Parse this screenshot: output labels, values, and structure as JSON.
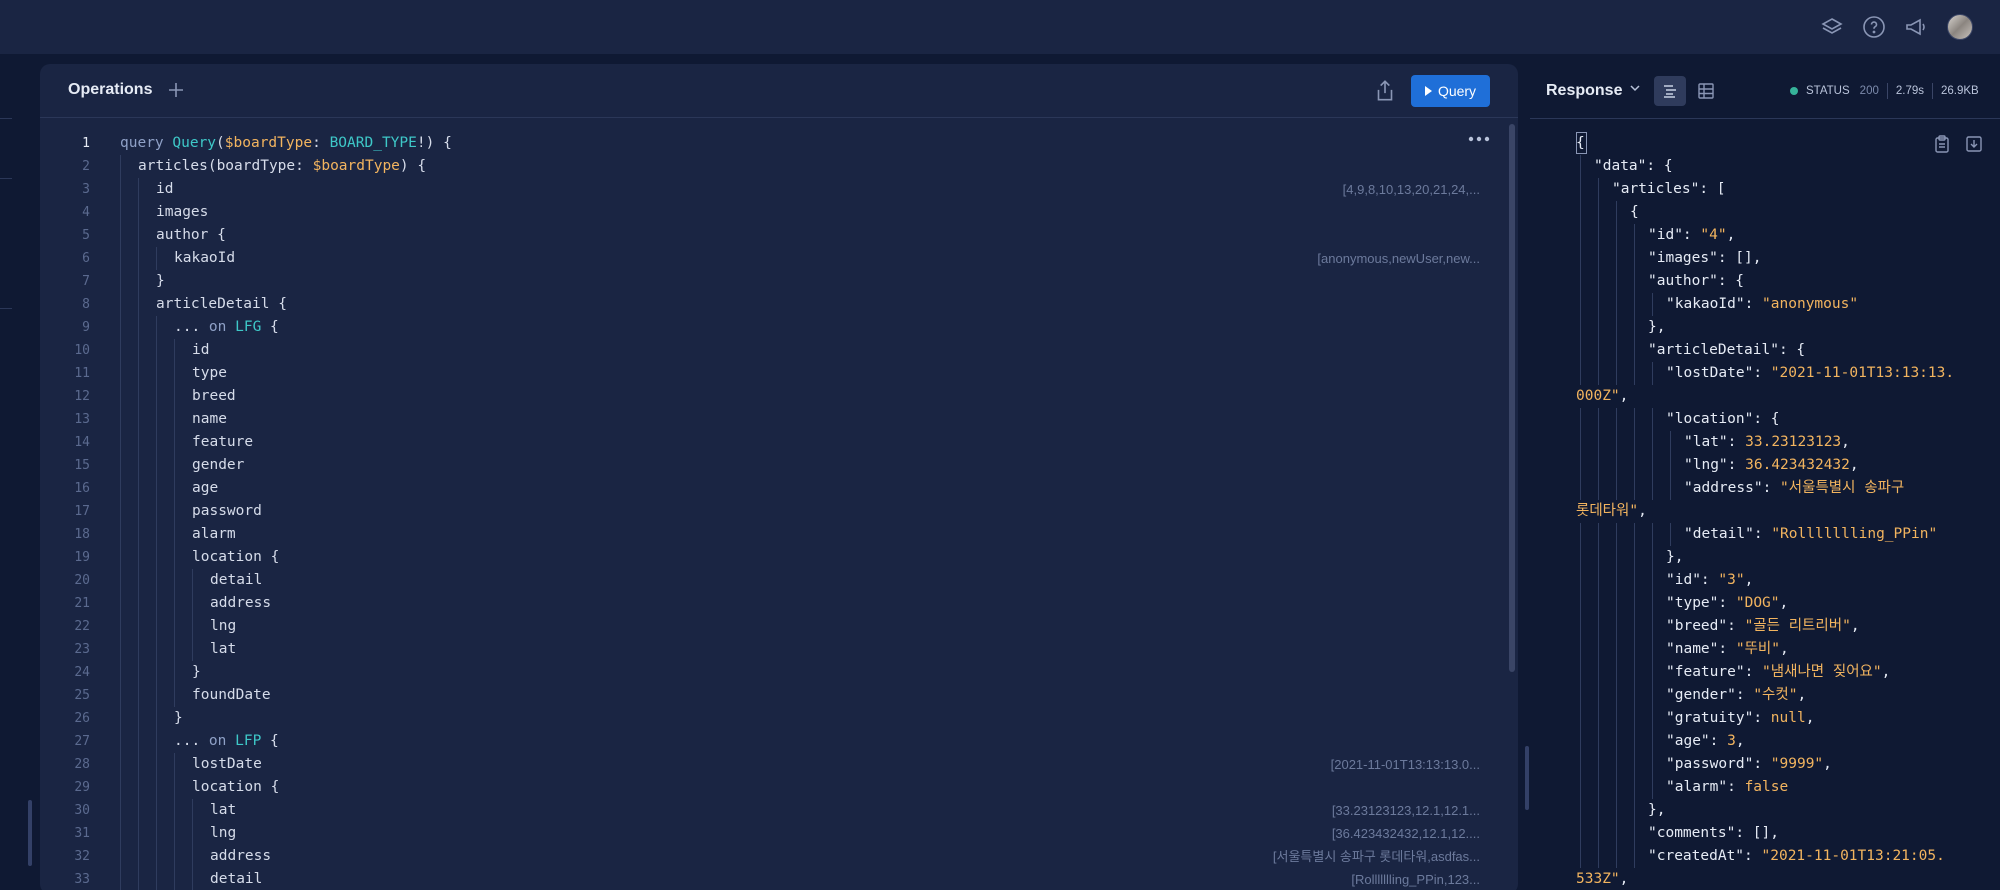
{
  "topbar": {
    "icons": [
      "layers-icon",
      "help-icon",
      "megaphone-icon"
    ],
    "avatar": "user-avatar"
  },
  "operations": {
    "title": "Operations",
    "add_icon": "plus-icon",
    "share_icon": "share-icon",
    "query_button": "Query",
    "menu_icon": "more-horizontal-icon",
    "lines": [
      {
        "n": "1",
        "indent": 0,
        "parts": [
          [
            "kw",
            "query "
          ],
          [
            "ty",
            "Query"
          ],
          [
            "p",
            "("
          ],
          [
            "var",
            "$boardType"
          ],
          [
            "p",
            ": "
          ],
          [
            "ty",
            "BOARD_TYPE"
          ],
          [
            "p",
            "!) {"
          ]
        ],
        "hint": ""
      },
      {
        "n": "2",
        "indent": 1,
        "parts": [
          [
            "p",
            "articles(boardType: "
          ],
          [
            "var",
            "$boardType"
          ],
          [
            "p",
            ") {"
          ]
        ],
        "hint": ""
      },
      {
        "n": "3",
        "indent": 2,
        "parts": [
          [
            "p",
            "id"
          ]
        ],
        "hint": "[4,9,8,10,13,20,21,24,..."
      },
      {
        "n": "4",
        "indent": 2,
        "parts": [
          [
            "p",
            "images"
          ]
        ],
        "hint": ""
      },
      {
        "n": "5",
        "indent": 2,
        "parts": [
          [
            "p",
            "author {"
          ]
        ],
        "hint": ""
      },
      {
        "n": "6",
        "indent": 3,
        "parts": [
          [
            "p",
            "kakaoId"
          ]
        ],
        "hint": "[anonymous,newUser,new..."
      },
      {
        "n": "7",
        "indent": 2,
        "parts": [
          [
            "p",
            "}"
          ]
        ],
        "hint": ""
      },
      {
        "n": "8",
        "indent": 2,
        "parts": [
          [
            "p",
            "articleDetail {"
          ]
        ],
        "hint": ""
      },
      {
        "n": "9",
        "indent": 3,
        "parts": [
          [
            "p",
            "... "
          ],
          [
            "kw",
            "on "
          ],
          [
            "ty",
            "LFG"
          ],
          [
            "p",
            " {"
          ]
        ],
        "hint": ""
      },
      {
        "n": "10",
        "indent": 4,
        "parts": [
          [
            "p",
            "id"
          ]
        ],
        "hint": ""
      },
      {
        "n": "11",
        "indent": 4,
        "parts": [
          [
            "p",
            "type"
          ]
        ],
        "hint": ""
      },
      {
        "n": "12",
        "indent": 4,
        "parts": [
          [
            "p",
            "breed"
          ]
        ],
        "hint": ""
      },
      {
        "n": "13",
        "indent": 4,
        "parts": [
          [
            "p",
            "name"
          ]
        ],
        "hint": ""
      },
      {
        "n": "14",
        "indent": 4,
        "parts": [
          [
            "p",
            "feature"
          ]
        ],
        "hint": ""
      },
      {
        "n": "15",
        "indent": 4,
        "parts": [
          [
            "p",
            "gender"
          ]
        ],
        "hint": ""
      },
      {
        "n": "16",
        "indent": 4,
        "parts": [
          [
            "p",
            "age"
          ]
        ],
        "hint": ""
      },
      {
        "n": "17",
        "indent": 4,
        "parts": [
          [
            "p",
            "password"
          ]
        ],
        "hint": ""
      },
      {
        "n": "18",
        "indent": 4,
        "parts": [
          [
            "p",
            "alarm"
          ]
        ],
        "hint": ""
      },
      {
        "n": "19",
        "indent": 4,
        "parts": [
          [
            "p",
            "location {"
          ]
        ],
        "hint": ""
      },
      {
        "n": "20",
        "indent": 5,
        "parts": [
          [
            "p",
            "detail"
          ]
        ],
        "hint": ""
      },
      {
        "n": "21",
        "indent": 5,
        "parts": [
          [
            "p",
            "address"
          ]
        ],
        "hint": ""
      },
      {
        "n": "22",
        "indent": 5,
        "parts": [
          [
            "p",
            "lng"
          ]
        ],
        "hint": ""
      },
      {
        "n": "23",
        "indent": 5,
        "parts": [
          [
            "p",
            "lat"
          ]
        ],
        "hint": ""
      },
      {
        "n": "24",
        "indent": 4,
        "parts": [
          [
            "p",
            "}"
          ]
        ],
        "hint": ""
      },
      {
        "n": "25",
        "indent": 4,
        "parts": [
          [
            "p",
            "foundDate"
          ]
        ],
        "hint": ""
      },
      {
        "n": "26",
        "indent": 3,
        "parts": [
          [
            "p",
            "}"
          ]
        ],
        "hint": ""
      },
      {
        "n": "27",
        "indent": 3,
        "parts": [
          [
            "p",
            "... "
          ],
          [
            "kw",
            "on "
          ],
          [
            "ty",
            "LFP"
          ],
          [
            "p",
            " {"
          ]
        ],
        "hint": ""
      },
      {
        "n": "28",
        "indent": 4,
        "parts": [
          [
            "p",
            "lostDate"
          ]
        ],
        "hint": "[2021-11-01T13:13:13.0..."
      },
      {
        "n": "29",
        "indent": 4,
        "parts": [
          [
            "p",
            "location {"
          ]
        ],
        "hint": ""
      },
      {
        "n": "30",
        "indent": 5,
        "parts": [
          [
            "p",
            "lat"
          ]
        ],
        "hint": "[33.23123123,12.1,12.1..."
      },
      {
        "n": "31",
        "indent": 5,
        "parts": [
          [
            "p",
            "lng"
          ]
        ],
        "hint": "[36.423432432,12.1,12...."
      },
      {
        "n": "32",
        "indent": 5,
        "parts": [
          [
            "p",
            "address"
          ]
        ],
        "hint": "[서울특별시 송파구 롯데타워,asdfas..."
      },
      {
        "n": "33",
        "indent": 5,
        "parts": [
          [
            "p",
            "detail"
          ]
        ],
        "hint": "[Rollllllling_PPin,123..."
      }
    ]
  },
  "response": {
    "title": "Response",
    "chevron_icon": "chevron-down-icon",
    "view_json_icon": "list-view-icon",
    "view_table_icon": "table-view-icon",
    "status_label": "STATUS",
    "status_code": "200",
    "time": "2.79s",
    "size": "26.9KB",
    "copy_icon": "clipboard-icon",
    "download_icon": "download-icon",
    "lines": [
      {
        "indent": 0,
        "parts": [
          [
            "p",
            "{"
          ]
        ]
      },
      {
        "indent": 1,
        "parts": [
          [
            "k",
            "\"data\""
          ],
          [
            "p",
            ": {"
          ]
        ]
      },
      {
        "indent": 2,
        "parts": [
          [
            "k",
            "\"articles\""
          ],
          [
            "p",
            ": ["
          ]
        ]
      },
      {
        "indent": 3,
        "parts": [
          [
            "p",
            "{"
          ]
        ]
      },
      {
        "indent": 4,
        "parts": [
          [
            "k",
            "\"id\""
          ],
          [
            "p",
            ": "
          ],
          [
            "s",
            "\"4\""
          ],
          [
            "p",
            ","
          ]
        ]
      },
      {
        "indent": 4,
        "parts": [
          [
            "k",
            "\"images\""
          ],
          [
            "p",
            ": [],"
          ]
        ]
      },
      {
        "indent": 4,
        "parts": [
          [
            "k",
            "\"author\""
          ],
          [
            "p",
            ": {"
          ]
        ]
      },
      {
        "indent": 5,
        "parts": [
          [
            "k",
            "\"kakaoId\""
          ],
          [
            "p",
            ": "
          ],
          [
            "s",
            "\"anonymous\""
          ]
        ]
      },
      {
        "indent": 4,
        "parts": [
          [
            "p",
            "},"
          ]
        ]
      },
      {
        "indent": 4,
        "parts": [
          [
            "k",
            "\"articleDetail\""
          ],
          [
            "p",
            ": {"
          ]
        ]
      },
      {
        "indent": 5,
        "parts": [
          [
            "k",
            "\"lostDate\""
          ],
          [
            "p",
            ": "
          ],
          [
            "s",
            "\"2021-11-01T13:13:13."
          ]
        ]
      },
      {
        "indent": -1,
        "parts": [
          [
            "s",
            "000Z\""
          ],
          [
            "p",
            ","
          ]
        ]
      },
      {
        "indent": 5,
        "parts": [
          [
            "k",
            "\"location\""
          ],
          [
            "p",
            ": {"
          ]
        ]
      },
      {
        "indent": 6,
        "parts": [
          [
            "k",
            "\"lat\""
          ],
          [
            "p",
            ": "
          ],
          [
            "s",
            "33.23123123"
          ],
          [
            "p",
            ","
          ]
        ]
      },
      {
        "indent": 6,
        "parts": [
          [
            "k",
            "\"lng\""
          ],
          [
            "p",
            ": "
          ],
          [
            "s",
            "36.423432432"
          ],
          [
            "p",
            ","
          ]
        ]
      },
      {
        "indent": 6,
        "parts": [
          [
            "k",
            "\"address\""
          ],
          [
            "p",
            ": "
          ],
          [
            "s",
            "\"서울특별시 송파구"
          ]
        ]
      },
      {
        "indent": -1,
        "parts": [
          [
            "s",
            "롯데타워\""
          ],
          [
            "p",
            ","
          ]
        ]
      },
      {
        "indent": 6,
        "parts": [
          [
            "k",
            "\"detail\""
          ],
          [
            "p",
            ": "
          ],
          [
            "s",
            "\"Rollllllling_PPin\""
          ]
        ]
      },
      {
        "indent": 5,
        "parts": [
          [
            "p",
            "},"
          ]
        ]
      },
      {
        "indent": 5,
        "parts": [
          [
            "k",
            "\"id\""
          ],
          [
            "p",
            ": "
          ],
          [
            "s",
            "\"3\""
          ],
          [
            "p",
            ","
          ]
        ]
      },
      {
        "indent": 5,
        "parts": [
          [
            "k",
            "\"type\""
          ],
          [
            "p",
            ": "
          ],
          [
            "s",
            "\"DOG\""
          ],
          [
            "p",
            ","
          ]
        ]
      },
      {
        "indent": 5,
        "parts": [
          [
            "k",
            "\"breed\""
          ],
          [
            "p",
            ": "
          ],
          [
            "s",
            "\"골든 리트리버\""
          ],
          [
            "p",
            ","
          ]
        ]
      },
      {
        "indent": 5,
        "parts": [
          [
            "k",
            "\"name\""
          ],
          [
            "p",
            ": "
          ],
          [
            "s",
            "\"뚜비\""
          ],
          [
            "p",
            ","
          ]
        ]
      },
      {
        "indent": 5,
        "parts": [
          [
            "k",
            "\"feature\""
          ],
          [
            "p",
            ": "
          ],
          [
            "s",
            "\"냄새나면 짖어요\""
          ],
          [
            "p",
            ","
          ]
        ]
      },
      {
        "indent": 5,
        "parts": [
          [
            "k",
            "\"gender\""
          ],
          [
            "p",
            ": "
          ],
          [
            "s",
            "\"수컷\""
          ],
          [
            "p",
            ","
          ]
        ]
      },
      {
        "indent": 5,
        "parts": [
          [
            "k",
            "\"gratuity\""
          ],
          [
            "p",
            ": "
          ],
          [
            "s",
            "null"
          ],
          [
            "p",
            ","
          ]
        ]
      },
      {
        "indent": 5,
        "parts": [
          [
            "k",
            "\"age\""
          ],
          [
            "p",
            ": "
          ],
          [
            "s",
            "3"
          ],
          [
            "p",
            ","
          ]
        ]
      },
      {
        "indent": 5,
        "parts": [
          [
            "k",
            "\"password\""
          ],
          [
            "p",
            ": "
          ],
          [
            "s",
            "\"9999\""
          ],
          [
            "p",
            ","
          ]
        ]
      },
      {
        "indent": 5,
        "parts": [
          [
            "k",
            "\"alarm\""
          ],
          [
            "p",
            ": "
          ],
          [
            "s",
            "false"
          ]
        ]
      },
      {
        "indent": 4,
        "parts": [
          [
            "p",
            "},"
          ]
        ]
      },
      {
        "indent": 4,
        "parts": [
          [
            "k",
            "\"comments\""
          ],
          [
            "p",
            ": [],"
          ]
        ]
      },
      {
        "indent": 4,
        "parts": [
          [
            "k",
            "\"createdAt\""
          ],
          [
            "p",
            ": "
          ],
          [
            "s",
            "\"2021-11-01T13:21:05."
          ]
        ]
      },
      {
        "indent": -1,
        "parts": [
          [
            "s",
            "533Z\""
          ],
          [
            "p",
            ","
          ]
        ]
      }
    ]
  }
}
